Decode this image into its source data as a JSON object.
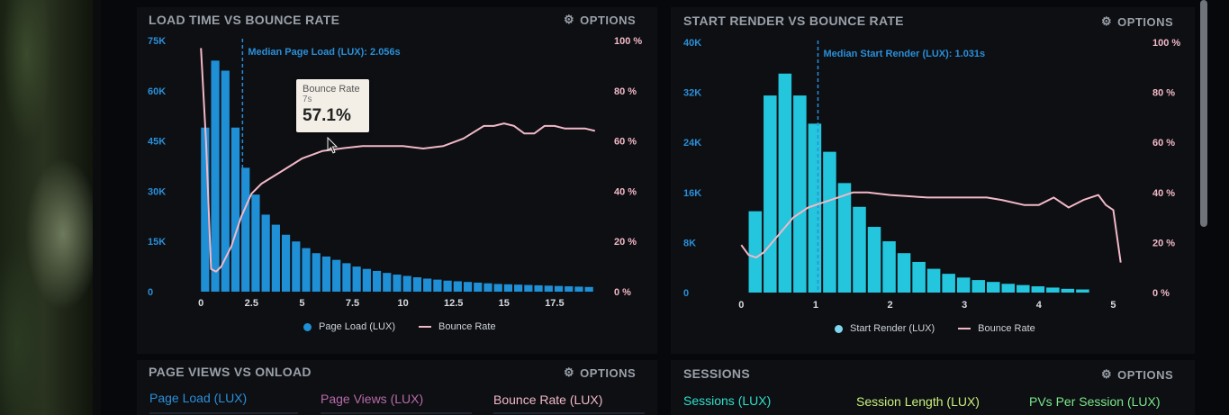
{
  "colors": {
    "bar_blue": "#1f8fd6",
    "bar_cyan": "#23c6dd",
    "bounce_line": "#f2b8c6",
    "median_line": "#2b8ad6",
    "axis_blue": "#2a8fd8",
    "axis_pink": "#f2b8c6"
  },
  "panels": {
    "load": {
      "title": "LOAD TIME VS BOUNCE RATE",
      "options": "OPTIONS"
    },
    "render": {
      "title": "START RENDER VS BOUNCE RATE",
      "options": "OPTIONS"
    },
    "pageviews": {
      "title": "PAGE VIEWS VS ONLOAD",
      "options": "OPTIONS",
      "tabs": [
        {
          "label": "Page Load (LUX)",
          "color": "#2a8fd8"
        },
        {
          "label": "Page Views (LUX)",
          "color": "#b86aa8"
        },
        {
          "label": "Bounce Rate (LUX)",
          "color": "#f2b8c6"
        }
      ]
    },
    "sessions": {
      "title": "SESSIONS",
      "options": "OPTIONS",
      "tabs": [
        {
          "label": "Sessions (LUX)",
          "color": "#2fe0c8"
        },
        {
          "label": "Session Length (LUX)",
          "color": "#c9f07a"
        },
        {
          "label": "PVs Per Session (LUX)",
          "color": "#7be88a"
        }
      ]
    }
  },
  "tooltip": {
    "title": "Bounce Rate",
    "subtitle": "7s",
    "value": "57.1%"
  },
  "chart_data": [
    {
      "type": "bar",
      "title": "LOAD TIME VS BOUNCE RATE",
      "x_ticks": [
        "0",
        "2.5",
        "5",
        "7.5",
        "10",
        "12.5",
        "15",
        "17.5"
      ],
      "x_tick_values": [
        0,
        2.5,
        5,
        7.5,
        10,
        12.5,
        15,
        17.5
      ],
      "xlim": [
        -0.5,
        20
      ],
      "y_left_ticks": [
        "0",
        "15K",
        "30K",
        "45K",
        "60K",
        "75K"
      ],
      "ylim_left": [
        0,
        75000
      ],
      "y_right_ticks": [
        "0 %",
        "20 %",
        "40 %",
        "60 %",
        "80 %",
        "100 %"
      ],
      "ylim_right": [
        0,
        100
      ],
      "median": {
        "x": 2.056,
        "label": "Median Page Load (LUX): 2.056s"
      },
      "series": [
        {
          "name": "Page Load (LUX)",
          "kind": "bar",
          "bin_start": 0,
          "bin_width": 0.5,
          "values": [
            49000,
            69000,
            66000,
            49000,
            37000,
            29000,
            23000,
            20000,
            17000,
            15000,
            13000,
            11500,
            10500,
            9500,
            8500,
            7500,
            6800,
            6200,
            5600,
            5100,
            4700,
            4300,
            3900,
            3600,
            3300,
            3100,
            2900,
            2700,
            2500,
            2300,
            2200,
            2100,
            2000,
            1900,
            1800,
            1700,
            1600,
            1500,
            1400
          ]
        },
        {
          "name": "Bounce Rate",
          "kind": "line",
          "x": [
            0,
            0.25,
            0.5,
            0.75,
            1,
            1.5,
            2,
            2.5,
            3,
            4,
            5,
            6,
            7,
            8,
            9,
            10,
            11,
            12,
            13,
            14,
            14.5,
            15,
            15.5,
            16,
            16.5,
            17,
            17.5,
            18,
            18.5,
            19,
            19.5
          ],
          "y": [
            97,
            60,
            9,
            8,
            10,
            18,
            30,
            39,
            43,
            48,
            53,
            56,
            57.1,
            58,
            58,
            58,
            57,
            58,
            61,
            66,
            66,
            67,
            66,
            63,
            63,
            66,
            66,
            65,
            65,
            65,
            64
          ]
        }
      ],
      "legend": [
        "Page Load (LUX)",
        "Bounce Rate"
      ]
    },
    {
      "type": "bar",
      "title": "START RENDER VS BOUNCE RATE",
      "x_ticks": [
        "0",
        "1",
        "2",
        "3",
        "4",
        "5"
      ],
      "x_tick_values": [
        0,
        1,
        2,
        3,
        4,
        5
      ],
      "xlim": [
        -0.1,
        5.2
      ],
      "y_left_ticks": [
        "0",
        "8K",
        "16K",
        "24K",
        "32K",
        "40K"
      ],
      "ylim_left": [
        0,
        40000
      ],
      "y_right_ticks": [
        "0 %",
        "20 %",
        "40 %",
        "60 %",
        "80 %",
        "100 %"
      ],
      "ylim_right": [
        0,
        100
      ],
      "median": {
        "x": 1.031,
        "label": "Median Start Render (LUX): 1.031s"
      },
      "series": [
        {
          "name": "Start Render (LUX)",
          "kind": "bar",
          "bin_start": 0.1,
          "bin_width": 0.2,
          "values": [
            13000,
            31500,
            35000,
            31500,
            27000,
            22500,
            17500,
            13700,
            10500,
            8200,
            6300,
            4900,
            3800,
            3000,
            2400,
            2000,
            1700,
            1400,
            1200,
            1000,
            800,
            600,
            500
          ]
        },
        {
          "name": "Bounce Rate",
          "kind": "line",
          "x": [
            0,
            0.1,
            0.2,
            0.3,
            0.5,
            0.7,
            0.9,
            1.1,
            1.3,
            1.5,
            1.7,
            2,
            2.5,
            3,
            3.3,
            3.5,
            3.8,
            4,
            4.2,
            4.4,
            4.6,
            4.8,
            4.9,
            5,
            5.1
          ],
          "y": [
            19,
            15,
            14,
            16,
            23,
            30,
            34,
            36,
            38,
            40,
            40,
            39,
            38,
            38,
            38,
            37,
            35,
            35,
            38,
            34,
            37,
            39,
            35,
            33,
            12
          ]
        }
      ],
      "legend": [
        "Start Render (LUX)",
        "Bounce Rate"
      ]
    }
  ]
}
